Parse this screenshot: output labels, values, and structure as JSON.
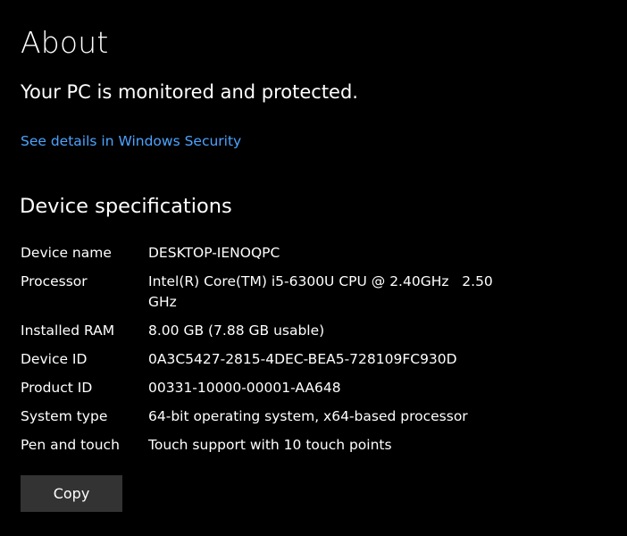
{
  "page": {
    "title": "About",
    "status": "Your PC is monitored and protected.",
    "security_link": "See details in Windows Security"
  },
  "specs": {
    "section_title": "Device specifications",
    "rows": [
      {
        "label": "Device name",
        "value": "DESKTOP-IENOQPC"
      },
      {
        "label": "Processor",
        "value": "Intel(R) Core(TM) i5-6300U CPU @ 2.40GHz   2.50 GHz"
      },
      {
        "label": "Installed RAM",
        "value": "8.00 GB (7.88 GB usable)"
      },
      {
        "label": "Device ID",
        "value": "0A3C5427-2815-4DEC-BEA5-728109FC930D"
      },
      {
        "label": "Product ID",
        "value": "00331-10000-00001-AA648"
      },
      {
        "label": "System type",
        "value": "64-bit operating system, x64-based processor"
      },
      {
        "label": "Pen and touch",
        "value": "Touch support with 10 touch points"
      }
    ]
  },
  "actions": {
    "copy_label": "Copy"
  },
  "colors": {
    "background": "#000000",
    "text": "#ffffff",
    "link": "#4da3ff",
    "button": "#333333"
  }
}
